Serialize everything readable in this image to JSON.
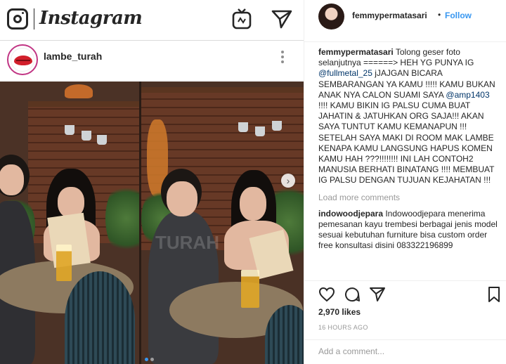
{
  "topbar": {
    "wordmark": "Instagram",
    "icons": [
      "camera-icon",
      "igtv-icon",
      "direct-send-icon"
    ]
  },
  "post": {
    "username": "lambe_turah",
    "watermark": "TURAH",
    "carousel_total": 2,
    "carousel_current": 1
  },
  "side": {
    "username": "femmypermatasari",
    "separator": "•",
    "follow_label": "Follow",
    "caption": {
      "user": "femmypermatasari",
      "part1": " Tolong geser foto selanjutnya ======> HEH YG PUNYA IG ",
      "mention1": "@fullmetal_25",
      "part2": " jJAJGAN BICARA SEMBARANGAN YA KAMU !!!!! KAMU BUKAN ANAK NYA CALON SUAMI SAYA ",
      "mention2": "@amp1403",
      "part3": " !!!! KAMU BIKIN IG PALSU CUMA BUAT JAHATIN & JATUHKAN ORG SAJA!!! AKAN SAYA TUNTUT KAMU KEMANAPUN !!! SETELAH SAYA MAKI DI ROOM MAK LAMBE KENAPA KAMU LANGSUNG HAPUS KOMEN KAMU HAH ???!!!!!!!! INI LAH CONTOH2 MANUSIA BERHATI BINATANG !!!! MEMBUAT IG PALSU DENGAN TUJUAN KEJAHATAN !!!"
    },
    "load_more": "Load more comments",
    "comment2": {
      "user": "indowoodjepara",
      "text": " Indowoodjepara menerima pemesanan kayu trembesi berbagai jenis model sesuai kebutuhan furniture bisa custom order free konsultasi disini 083322196899"
    },
    "likes": "2,970 likes",
    "timestamp": "16 HOURS AGO",
    "add_comment_placeholder": "Add a comment...",
    "colors": {
      "accent": "#3897f0",
      "text": "#262626",
      "muted": "#999999"
    }
  }
}
